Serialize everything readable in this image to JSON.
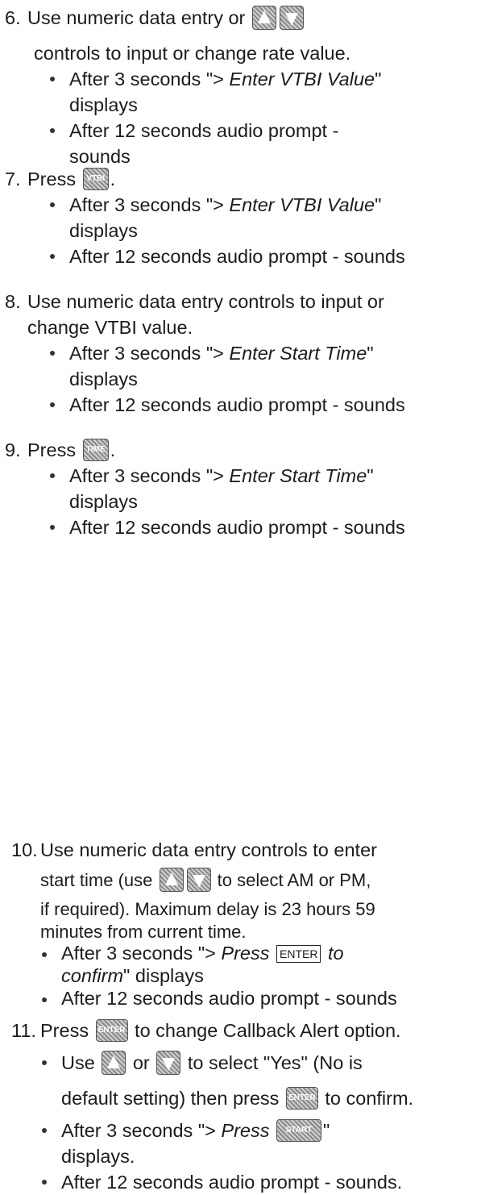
{
  "steps": [
    {
      "number": "6.",
      "line1": "Use numeric data entry or",
      "line2": "controls to input or change rate value.",
      "keys": [
        "up-arrow-key",
        "down-arrow-key"
      ],
      "bullets": [
        {
          "a": "After 3 seconds \"> ",
          "em": "Enter VTBI Value",
          "b": "\"",
          "c": "displays"
        },
        {
          "a": "After 12 seconds audio prompt -",
          "c": "sounds"
        }
      ]
    },
    {
      "number": "7.",
      "line1": "Press",
      "key": "VTBI",
      "line1_end": ".",
      "bullets": [
        {
          "a": "After 3 seconds \"> ",
          "em": "Enter VTBI Value",
          "b": "\"",
          "c": "displays"
        },
        {
          "a": "After 12 seconds audio prompt - sounds"
        }
      ]
    },
    {
      "number": "8.",
      "line1": "Use numeric data entry controls to input or",
      "line2": "change VTBI value.",
      "bullets": [
        {
          "a": "After 3 seconds \"> ",
          "em": "Enter Start Time",
          "b": "\"",
          "c": "displays"
        },
        {
          "a": "After 12 seconds audio prompt - sounds"
        }
      ]
    },
    {
      "number": "9.",
      "line1": "Press",
      "key": "TIME",
      "line1_end": ".",
      "bullets": [
        {
          "a": "After 3 seconds \"> ",
          "em": "Enter Start Time",
          "b": "\"",
          "c": "displays"
        },
        {
          "a": "After 12 seconds audio prompt - sounds"
        }
      ]
    },
    {
      "number": "10.",
      "line1": "Use numeric data entry controls to enter",
      "line2a": "start time (use",
      "line2b": "to select AM or PM,",
      "line3": "if required). Maximum delay is 23 hours 59",
      "line4": "minutes from current time.",
      "bullets": [
        {
          "a": "After 3 seconds \"> ",
          "em": "Press",
          "key": "ENTER",
          "em2": "to",
          "c_em": "confirm",
          "c_rest": "\" displays"
        },
        {
          "a": "After 12 seconds audio prompt - sounds"
        }
      ]
    },
    {
      "number": "11.",
      "line1a": "Press",
      "key": "ENTER",
      "line1b": "to change Callback Alert option.",
      "bullets": [
        {
          "a": "Use",
          "mid": "or",
          "b": "to select \"Yes\" (No is",
          "c1": "default setting) then press",
          "c2": "to confirm."
        },
        {
          "a": "After 3 seconds \"> ",
          "em": "Press",
          "key": "START",
          "b": "\"",
          "c": "displays."
        },
        {
          "a": "After 12 seconds audio prompt - sounds."
        }
      ]
    }
  ]
}
